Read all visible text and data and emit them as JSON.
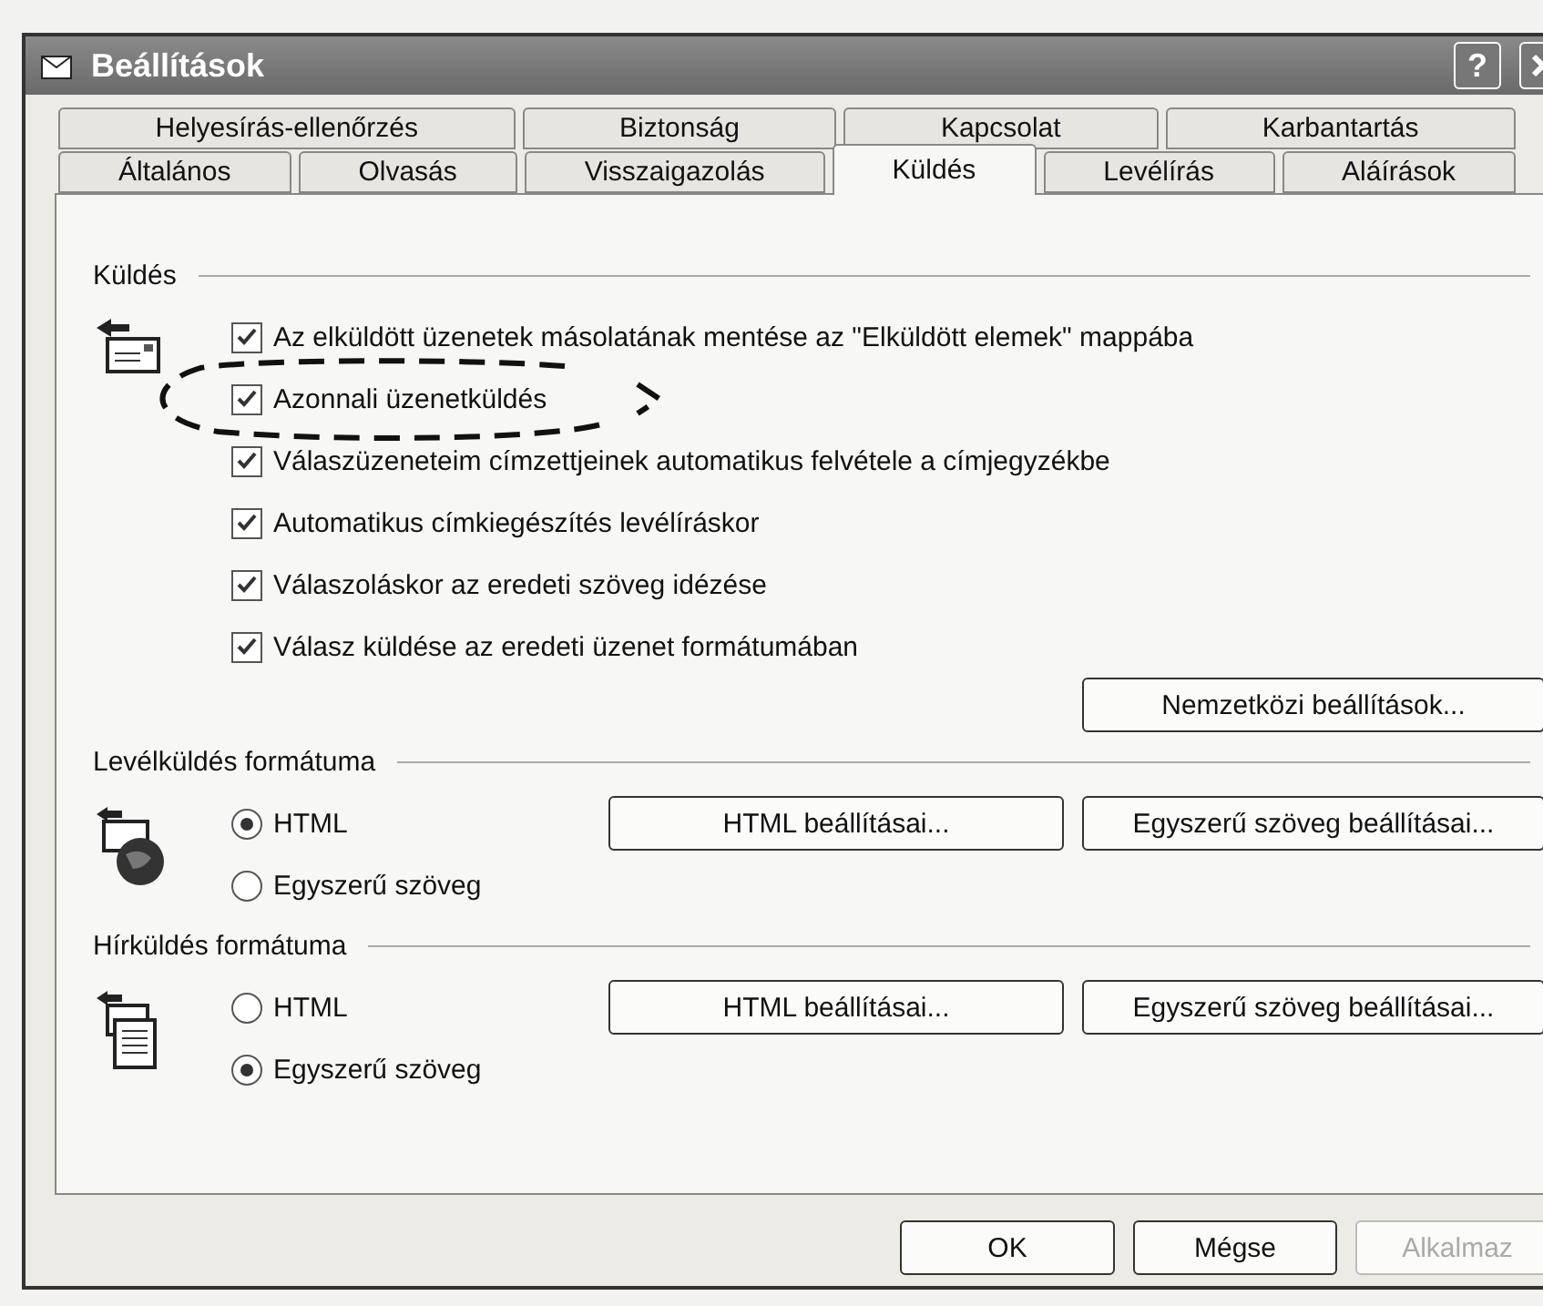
{
  "window": {
    "title": "Beállítások",
    "help_button": "?"
  },
  "tab_rows": [
    {
      "tabs": [
        {
          "label": "Helyesírás-ellenőrzés",
          "selected": false
        },
        {
          "label": "Biztonság",
          "selected": false
        },
        {
          "label": "Kapcsolat",
          "selected": false
        },
        {
          "label": "Karbantartás",
          "selected": false
        }
      ]
    },
    {
      "tabs": [
        {
          "label": "Általános",
          "selected": false
        },
        {
          "label": "Olvasás",
          "selected": false
        },
        {
          "label": "Visszaigazolás",
          "selected": false
        },
        {
          "label": "Küldés",
          "selected": true
        },
        {
          "label": "Levélírás",
          "selected": false
        },
        {
          "label": "Aláírások",
          "selected": false
        }
      ]
    }
  ],
  "sections": [
    {
      "kind": "checks",
      "title": "Küldés",
      "options": [
        {
          "label": "Az elküldött üzenetek másolatának mentése az \"Elküldött elemek\" mappába",
          "checked": true
        },
        {
          "label": "Azonnali üzenetküldés",
          "checked": true
        },
        {
          "label": "Válaszüzeneteim címzettjeinek automatikus felvétele a címjegyzékbe",
          "checked": true
        },
        {
          "label": "Automatikus címkiegészítés levélíráskor",
          "checked": true
        },
        {
          "label": "Válaszoláskor az eredeti szöveg idézése",
          "checked": true
        },
        {
          "label": "Válasz küldése az eredeti üzenet formátumában",
          "checked": true
        }
      ],
      "buttons": [
        "Nemzetközi beállítások..."
      ]
    },
    {
      "kind": "radios",
      "title": "Levélküldés formátuma",
      "options": [
        {
          "label": "HTML",
          "selected": true
        },
        {
          "label": "Egyszerű szöveg",
          "selected": false
        }
      ],
      "buttons": [
        "HTML beállításai...",
        "Egyszerű szöveg beállításai..."
      ]
    },
    {
      "kind": "radios",
      "title": "Hírküldés formátuma",
      "options": [
        {
          "label": "HTML",
          "selected": false
        },
        {
          "label": "Egyszerű szöveg",
          "selected": true
        }
      ],
      "buttons": [
        "HTML beállításai...",
        "Egyszerű szöveg beállításai..."
      ]
    }
  ],
  "buttons": [
    {
      "label": "OK",
      "disabled": false
    },
    {
      "label": "Mégse",
      "disabled": false
    },
    {
      "label": "Alkalmaz",
      "disabled": true
    }
  ]
}
